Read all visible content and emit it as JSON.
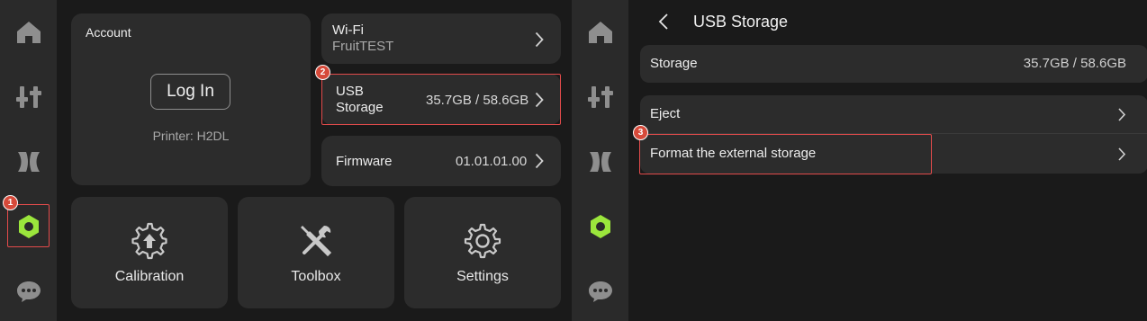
{
  "colors": {
    "accent_active": "#9be63c",
    "highlight": "#e24b4b",
    "badge": "#d64a3a"
  },
  "sidebar_icons": [
    "home-icon",
    "controls-icon",
    "filament-icon",
    "settings-hex-icon",
    "chat-icon"
  ],
  "left_screen": {
    "account": {
      "title": "Account",
      "login_label": "Log In",
      "printer": "Printer: H2DL"
    },
    "wifi": {
      "title": "Wi-Fi",
      "network": "FruitTEST"
    },
    "usb": {
      "title_line1": "USB",
      "title_line2": "Storage",
      "value": "35.7GB / 58.6GB"
    },
    "firmware": {
      "title": "Firmware",
      "version": "01.01.01.00"
    },
    "tiles": [
      {
        "label": "Calibration",
        "icon": "calibration-icon"
      },
      {
        "label": "Toolbox",
        "icon": "toolbox-icon"
      },
      {
        "label": "Settings",
        "icon": "gear-icon"
      }
    ]
  },
  "right_screen": {
    "header_title": "USB Storage",
    "storage_label": "Storage",
    "storage_value": "35.7GB / 58.6GB",
    "eject_label": "Eject",
    "format_label": "Format the external storage"
  },
  "steps": [
    "1",
    "2",
    "3"
  ]
}
